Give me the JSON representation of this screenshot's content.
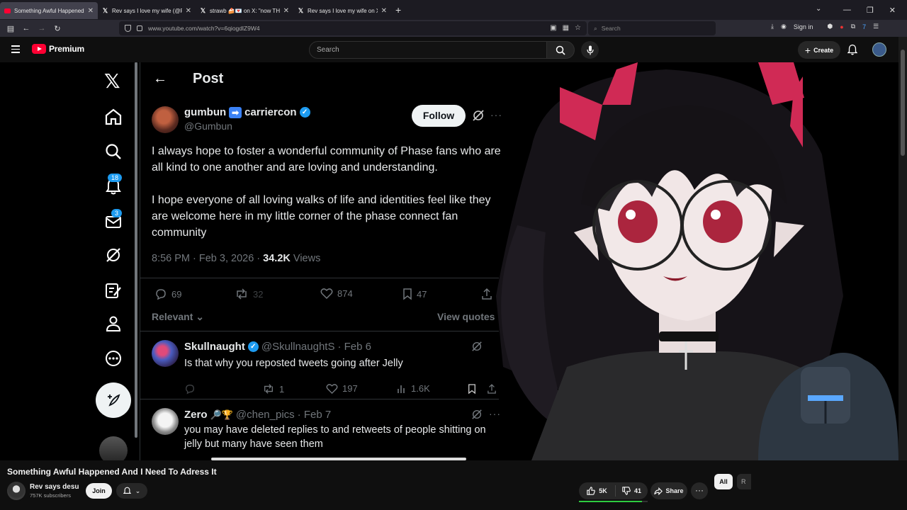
{
  "browser": {
    "tabs": [
      {
        "title": "Something Awful Happened An",
        "favicon": "youtube",
        "active": true
      },
      {
        "title": "Rev says I love my wife (@Rev_s",
        "favicon": "x",
        "active": false
      },
      {
        "title": "strawb 🍰💌 on X: \"now THIS is",
        "favicon": "x",
        "active": false
      },
      {
        "title": "Rev says I love my wife on X: \"-",
        "favicon": "x",
        "active": false
      }
    ],
    "new_tab": "+",
    "url": "www.youtube.com/watch?v=6qiogdlZ9W4",
    "search_placeholder": "Search",
    "sign_in": "Sign in",
    "window_controls": {
      "minimize": "—",
      "maximize": "❐",
      "close": "✕"
    }
  },
  "youtube": {
    "brand": "Premium",
    "search_placeholder": "Search",
    "create_label": "Create",
    "video": {
      "title": "Something Awful Happened And I Need To Adress It",
      "channel": "Rev says desu",
      "subscribers": "757K subscribers",
      "join_label": "Join",
      "likes": "5K",
      "dislikes": "41",
      "share_label": "Share",
      "like_ratio": 0.92
    },
    "chips": {
      "all": "All",
      "second": "R"
    }
  },
  "x_post": {
    "header": "Post",
    "author": {
      "name_left": "gumbun",
      "arrow": "➡",
      "name_right": "carriercon",
      "handle": "@Gumbun"
    },
    "follow_label": "Follow",
    "text_paragraphs": [
      "I always hope to foster a wonderful community of Phase fans who are all kind to one another and are loving and understanding.",
      "I hope everyone of all loving walks of life and identities feel like they are welcome here in my little corner of the phase connect fan community"
    ],
    "meta": {
      "time": "8:56 PM · Feb 3, 2026 · ",
      "views": "34.2K",
      "views_label": " Views"
    },
    "stats": {
      "replies": "69",
      "reposts": "32",
      "likes": "874",
      "bookmarks": "47"
    },
    "sort_label": "Relevant",
    "view_quotes": "View quotes",
    "badges": {
      "notifications": "18",
      "messages": "3"
    },
    "replies": [
      {
        "name": "Skullnaught",
        "handle": "@SkullnaughtS",
        "date": "· Feb 6",
        "text": "Is that why you reposted tweets going after Jelly",
        "reply_count": "",
        "reposts": "1",
        "likes": "197",
        "views": "1.6K"
      },
      {
        "name": "Zero",
        "emojis": "🔎🏆",
        "handle": "@chen_pics",
        "date": "· Feb 7",
        "text": "you may have deleted replies to and retweets of people shitting on jelly but many have seen them"
      }
    ]
  },
  "colors": {
    "accent_blue": "#1d9bf0",
    "yt_red": "#ff0033",
    "like_green": "#2ecc40"
  }
}
